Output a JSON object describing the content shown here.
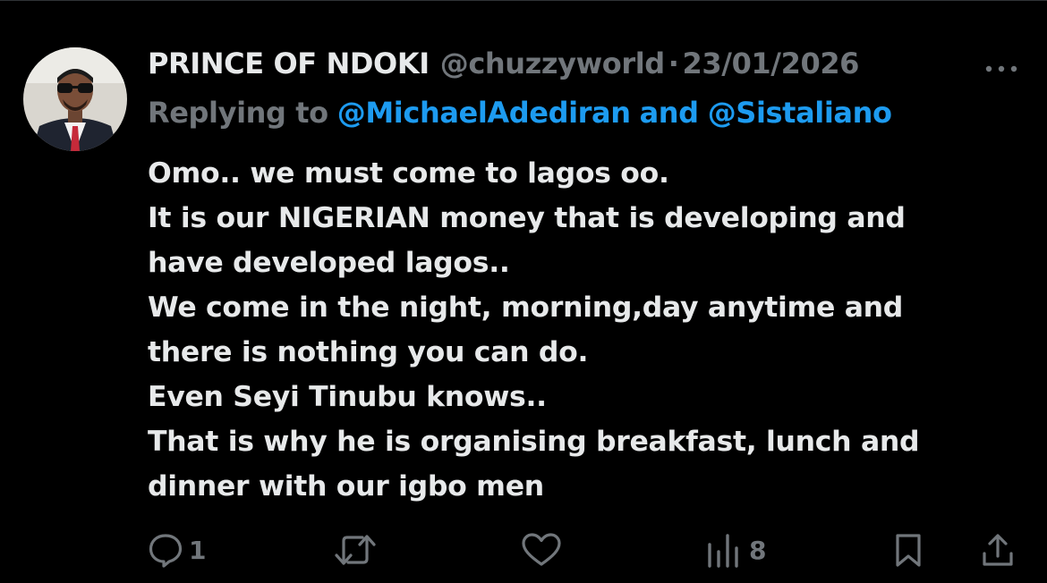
{
  "tweet": {
    "author_name": "PRINCE OF NDOKI",
    "author_handle": "@chuzzyworld",
    "separator": "·",
    "date": "23/01/2026",
    "replying_prefix": "Replying to",
    "replying_user_1": "@MichaelAdediran",
    "replying_and": "and",
    "replying_user_2": "@Sistaliano",
    "body_lines": [
      "Omo.. we must come to lagos oo.",
      "It is our NIGERIAN money that is developing and",
      "have developed lagos..",
      "We come in the night, morning,day anytime and",
      "there is nothing you can do.",
      "Even Seyi Tinubu knows..",
      "That is why he is organising breakfast, lunch and",
      "dinner with our igbo men"
    ]
  },
  "actions": {
    "reply_count": "1",
    "views_count": "8"
  },
  "icons": {
    "more": "more-horizontal-icon",
    "reply": "comment-bubble-icon",
    "repost": "repost-arrows-icon",
    "like": "heart-icon",
    "views": "bar-chart-icon",
    "bookmark": "bookmark-icon",
    "share": "share-upload-icon"
  },
  "colors": {
    "background": "#000000",
    "text": "#e7e9ea",
    "muted": "#71767b",
    "link": "#1d9bf0"
  }
}
